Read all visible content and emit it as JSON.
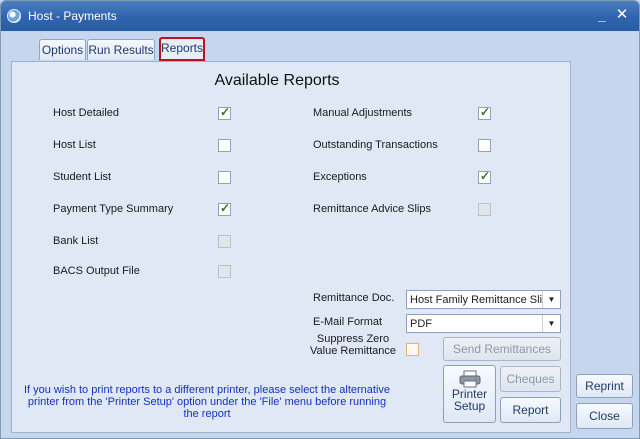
{
  "window": {
    "title": "Host - Payments"
  },
  "tabs": [
    {
      "label": "Options"
    },
    {
      "label": "Run Results"
    },
    {
      "label": "Reports"
    }
  ],
  "panel": {
    "title": "Available Reports",
    "left_reports": [
      {
        "label": "Host Detailed",
        "checked": true,
        "enabled": true
      },
      {
        "label": "Host List",
        "checked": false,
        "enabled": true
      },
      {
        "label": "Student List",
        "checked": false,
        "enabled": true
      },
      {
        "label": "Payment Type Summary",
        "checked": true,
        "enabled": true
      },
      {
        "label": "Bank List",
        "checked": false,
        "enabled": false
      },
      {
        "label": "BACS Output File",
        "checked": false,
        "enabled": false
      }
    ],
    "right_reports": [
      {
        "label": "Manual Adjustments",
        "checked": true,
        "enabled": true
      },
      {
        "label": "Outstanding Transactions",
        "checked": false,
        "enabled": true
      },
      {
        "label": "Exceptions",
        "checked": true,
        "enabled": true
      },
      {
        "label": "Remittance  Advice Slips",
        "checked": false,
        "enabled": false
      }
    ],
    "remittance_doc": {
      "label": "Remittance Doc.",
      "value": "Host Family Remittance Slip"
    },
    "email_format": {
      "label": "E-Mail Format",
      "value": "PDF"
    },
    "suppress_zero": {
      "label_line1": "Suppress Zero",
      "label_line2": "Value Remittance"
    },
    "buttons": {
      "send_remittances": "Send Remittances",
      "cheques": "Cheques",
      "printer_setup_line1": "Printer",
      "printer_setup_line2": "Setup",
      "report": "Report"
    },
    "note": "If you wish to print reports to a different printer, please select the alternative printer from the 'Printer Setup' option under the 'File' menu before running the report"
  },
  "side_buttons": {
    "reprint": "Reprint",
    "close": "Close"
  },
  "colors": {
    "titlebar": "#2f64ad",
    "tab_highlight": "#c1121c",
    "note_text": "#1730c2"
  }
}
